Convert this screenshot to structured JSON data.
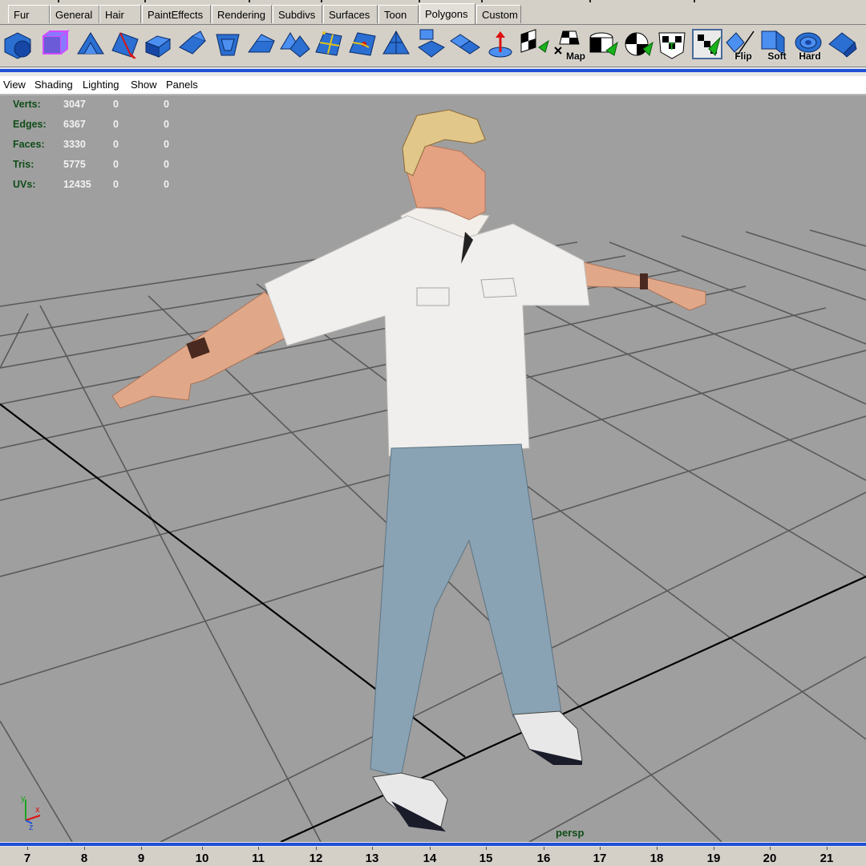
{
  "shelf_tabs": [
    {
      "label": "Fur",
      "active": false
    },
    {
      "label": "General",
      "active": false
    },
    {
      "label": "Hair",
      "active": false
    },
    {
      "label": "PaintEffects",
      "active": false
    },
    {
      "label": "Rendering",
      "active": false
    },
    {
      "label": "Subdivs",
      "active": false
    },
    {
      "label": "Surfaces",
      "active": false
    },
    {
      "label": "Toon",
      "active": false
    },
    {
      "label": "Polygons",
      "active": true
    },
    {
      "label": "Custom",
      "active": false
    }
  ],
  "shelf_icons": [
    {
      "name": "create-polygon-sphere-icon",
      "label": ""
    },
    {
      "name": "polygon-cube-wireframe-icon",
      "label": ""
    },
    {
      "name": "create-polygon-tool-icon",
      "label": ""
    },
    {
      "name": "split-polygon-tool-icon",
      "label": ""
    },
    {
      "name": "extrude-face-icon",
      "label": ""
    },
    {
      "name": "extrude-edge-icon",
      "label": ""
    },
    {
      "name": "bevel-icon",
      "label": ""
    },
    {
      "name": "poke-faces-icon",
      "label": ""
    },
    {
      "name": "wedge-faces-icon",
      "label": ""
    },
    {
      "name": "subdivide-faces-icon",
      "label": ""
    },
    {
      "name": "merge-vertices-icon",
      "label": ""
    },
    {
      "name": "triangulate-icon",
      "label": ""
    },
    {
      "name": "separate-icon",
      "label": ""
    },
    {
      "name": "combine-icon",
      "label": ""
    },
    {
      "name": "cut-faces-icon",
      "label": ""
    },
    {
      "name": "planar-map-icon",
      "label": ""
    },
    {
      "name": "auto-map-icon",
      "label": "Map"
    },
    {
      "name": "cylindrical-map-icon",
      "label": ""
    },
    {
      "name": "spherical-map-icon",
      "label": ""
    },
    {
      "name": "uv-texture-editor-icon",
      "label": ""
    },
    {
      "name": "checker-map-icon",
      "label": ""
    },
    {
      "name": "flip-normals-icon",
      "label": "Flip"
    },
    {
      "name": "soften-edge-icon",
      "label": "Soft"
    },
    {
      "name": "harden-edge-icon",
      "label": "Hard"
    },
    {
      "name": "smooth-icon",
      "label": ""
    }
  ],
  "panel_menu": [
    "View",
    "Shading",
    "Lighting",
    "Show",
    "Panels"
  ],
  "hud_stats": [
    {
      "label": "Verts:",
      "values": [
        "3047",
        "0",
        "0"
      ]
    },
    {
      "label": "Edges:",
      "values": [
        "6367",
        "0",
        "0"
      ]
    },
    {
      "label": "Faces:",
      "values": [
        "3330",
        "0",
        "0"
      ]
    },
    {
      "label": "Tris:",
      "values": [
        "5775",
        "0",
        "0"
      ]
    },
    {
      "label": "UVs:",
      "values": [
        "12435",
        "0",
        "0"
      ]
    }
  ],
  "camera_label": "persp",
  "axis_labels": {
    "y": "y",
    "x": "x",
    "z": "z"
  },
  "timeline_frames": [
    "7",
    "8",
    "9",
    "10",
    "11",
    "12",
    "13",
    "14",
    "15",
    "16",
    "17",
    "18",
    "19",
    "20",
    "21"
  ],
  "colors": {
    "accent_blue": "#1f4fd6",
    "viewport_bg": "#9f9f9f",
    "hud_green": "#0f4d18"
  }
}
